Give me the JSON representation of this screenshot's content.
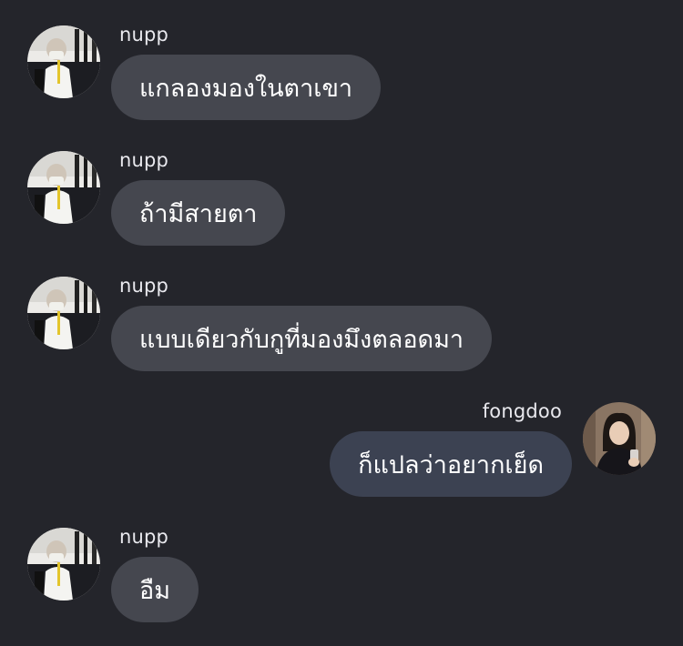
{
  "messages": [
    {
      "sender": "nupp",
      "text": "แกลองมองในตาเขา",
      "direction": "incoming",
      "avatar": "user-photo"
    },
    {
      "sender": "nupp",
      "text": "ถ้ามีสายตา",
      "direction": "incoming",
      "avatar": "user-photo"
    },
    {
      "sender": "nupp",
      "text": "แบบเดียวกับกูที่มองมึงตลอดมา",
      "direction": "incoming",
      "avatar": "user-photo"
    },
    {
      "sender": "fongdoo",
      "text": "ก็แปลว่าอยากเย็ด",
      "direction": "outgoing",
      "avatar": "user-photo"
    },
    {
      "sender": "nupp",
      "text": "อืม",
      "direction": "incoming",
      "avatar": "user-photo"
    }
  ],
  "colors": {
    "background": "#24252b",
    "incoming_bubble": "#45474f",
    "outgoing_bubble": "#3c4252",
    "text": "#ffffff",
    "sender_text": "#e9e9ee"
  }
}
